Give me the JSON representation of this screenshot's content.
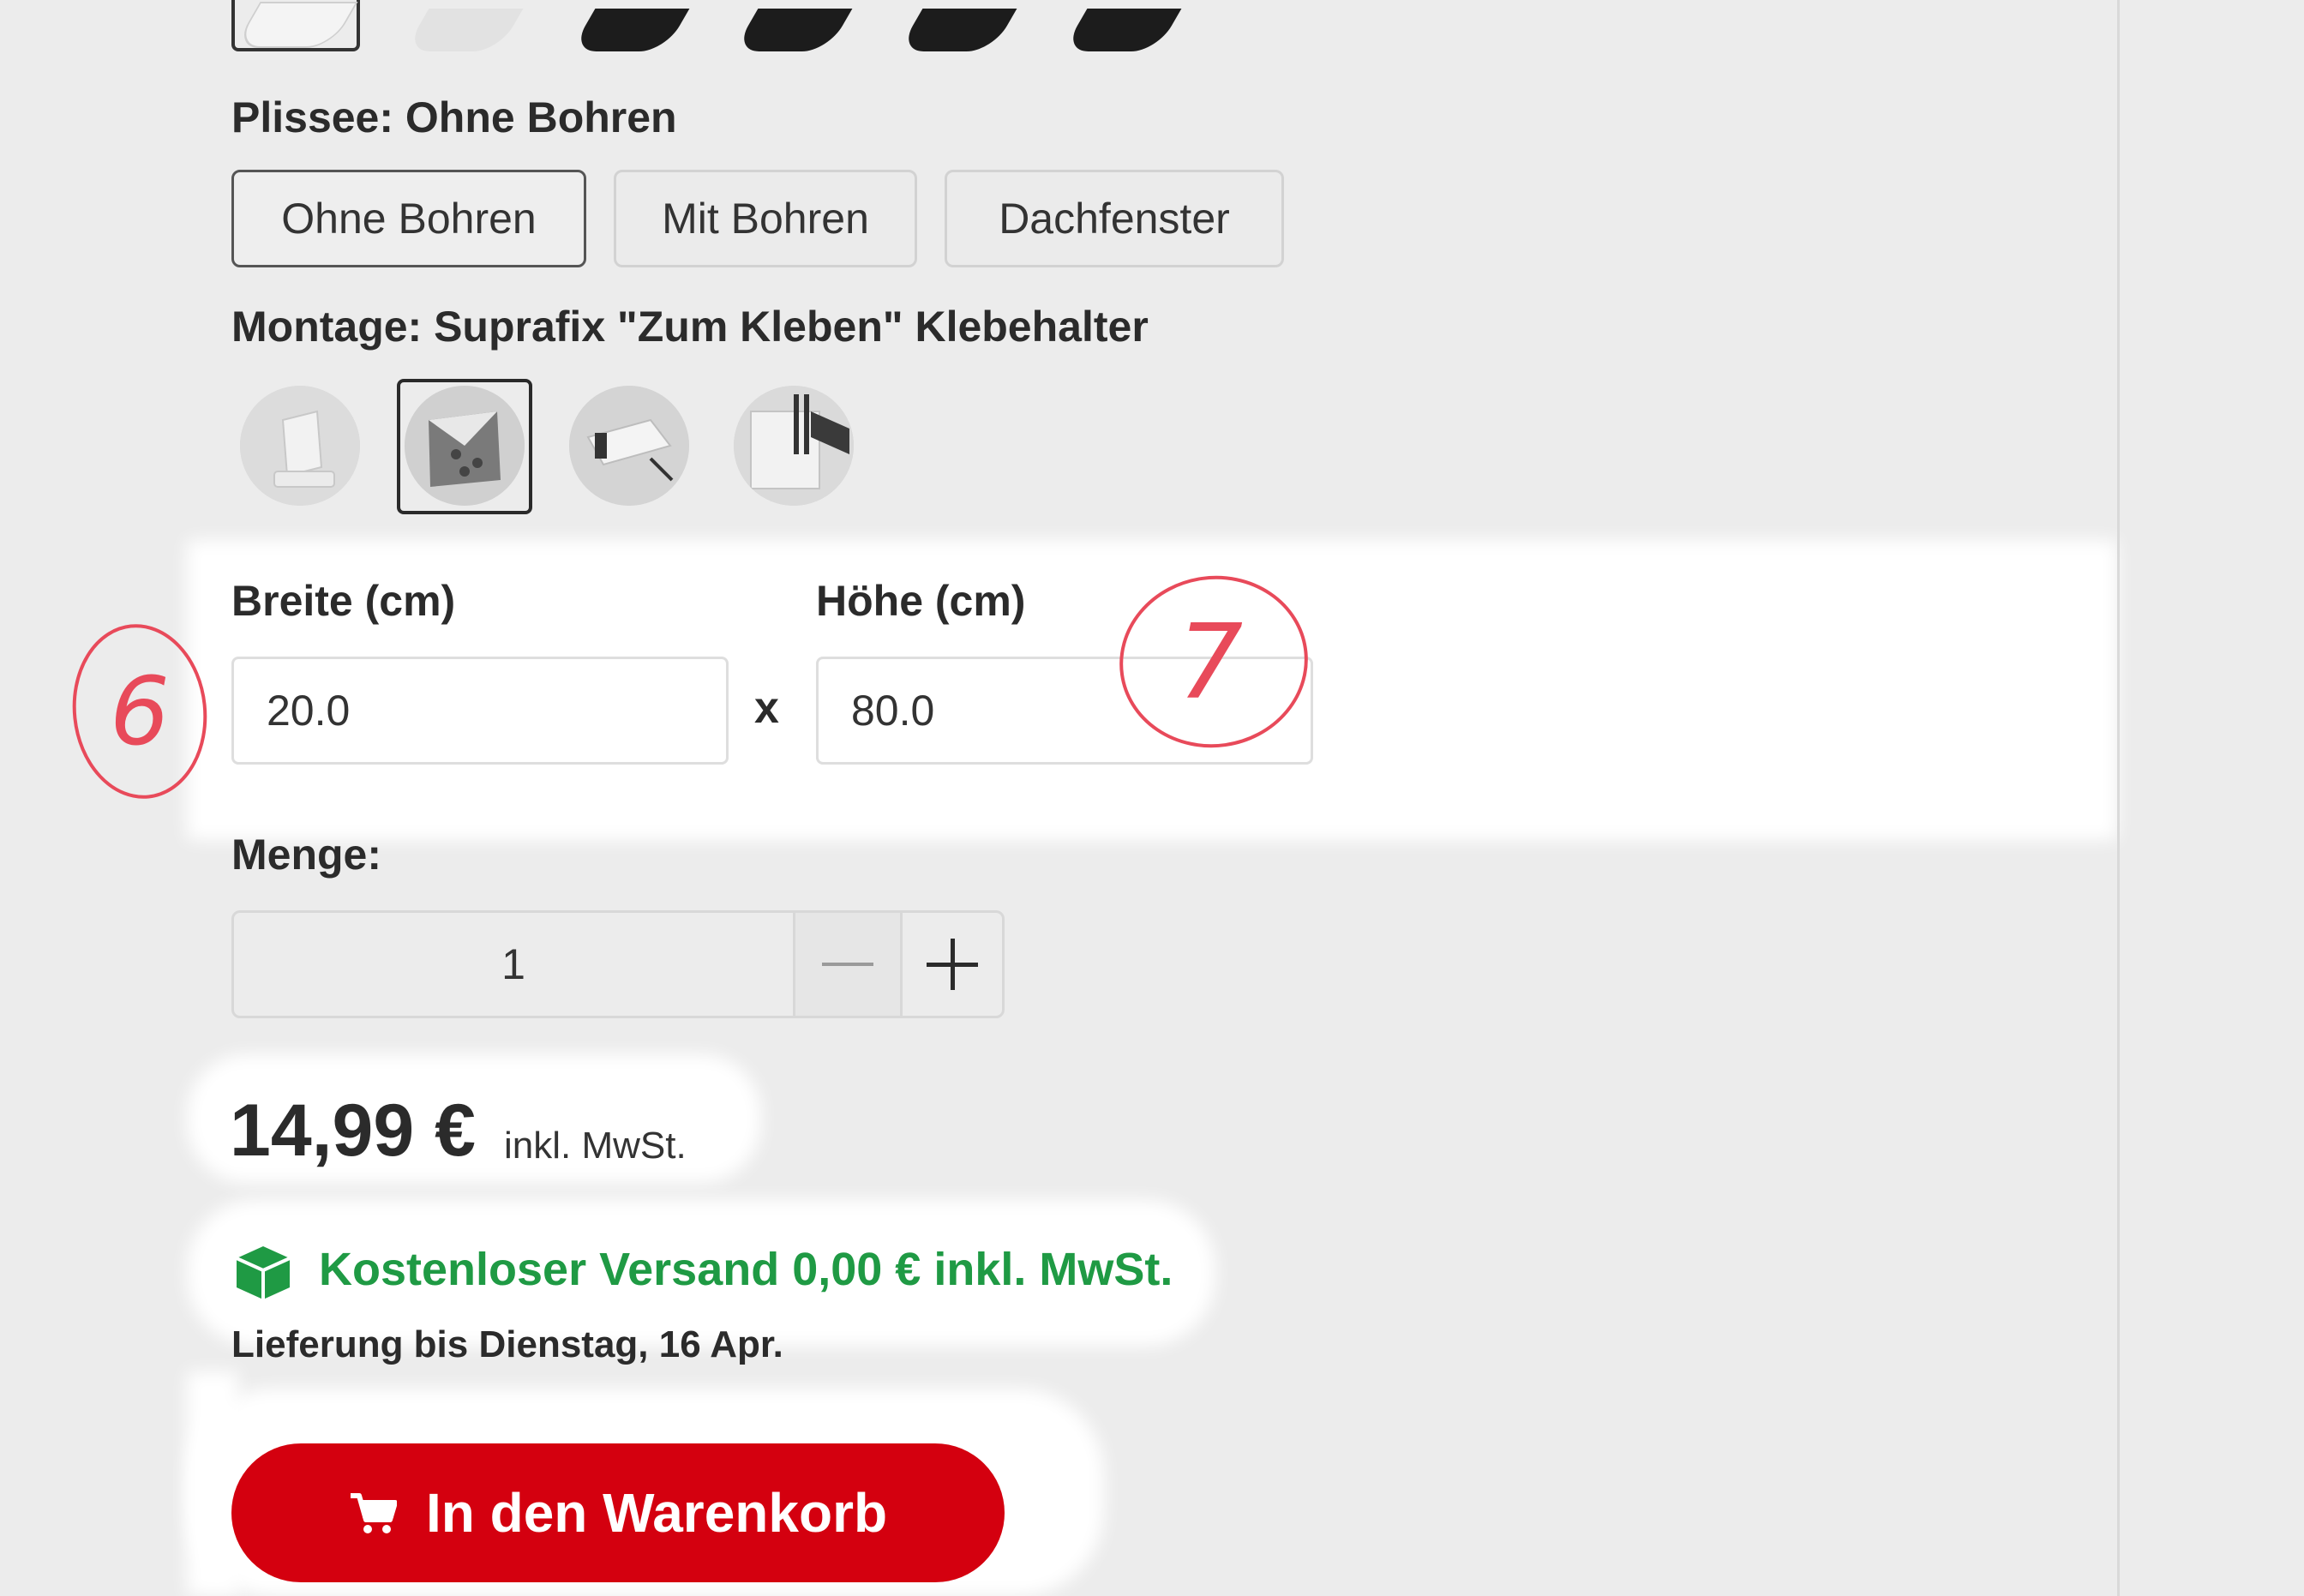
{
  "swatches": [
    {
      "name": "white",
      "color": "#ffffff",
      "selected": true
    },
    {
      "name": "light-grey",
      "color": "#e6e6e6",
      "selected": false
    },
    {
      "name": "black-1",
      "color": "#1c1c1c",
      "selected": false
    },
    {
      "name": "black-2",
      "color": "#1c1c1c",
      "selected": false
    },
    {
      "name": "black-3",
      "color": "#1c1c1c",
      "selected": false
    },
    {
      "name": "black-4",
      "color": "#1c1c1c",
      "selected": false
    }
  ],
  "plissee": {
    "label": "Plissee: Ohne Bohren",
    "options": [
      "Ohne Bohren",
      "Mit Bohren",
      "Dachfenster"
    ],
    "selected": "Ohne Bohren"
  },
  "montage": {
    "label": "Montage: Suprafix \"Zum Kleben\" Klebehalter",
    "options": [
      "clamp-bracket-icon",
      "adhesive-bracket-icon",
      "clip-holder-icon",
      "window-frame-icon"
    ],
    "selected_index": 1
  },
  "dimensions": {
    "width_label": "Breite (cm)",
    "width_value": "20.0",
    "separator": "x",
    "height_label": "Höhe (cm)",
    "height_value": "80.0"
  },
  "quantity": {
    "label": "Menge:",
    "value": "1"
  },
  "price": {
    "amount": "14,99 €",
    "note": "inkl. MwSt."
  },
  "shipping": {
    "text": "Kostenloser Versand 0,00 € inkl. MwSt.",
    "delivery": "Lieferung bis Dienstag, 16 Apr."
  },
  "cart_button": {
    "label": "In den Warenkorb"
  },
  "annotations": {
    "marker_6": "6",
    "marker_7": "7"
  },
  "colors": {
    "accent_red": "#d4000f",
    "shipping_green": "#1f9a44",
    "annotation_red": "#e84a5a"
  }
}
